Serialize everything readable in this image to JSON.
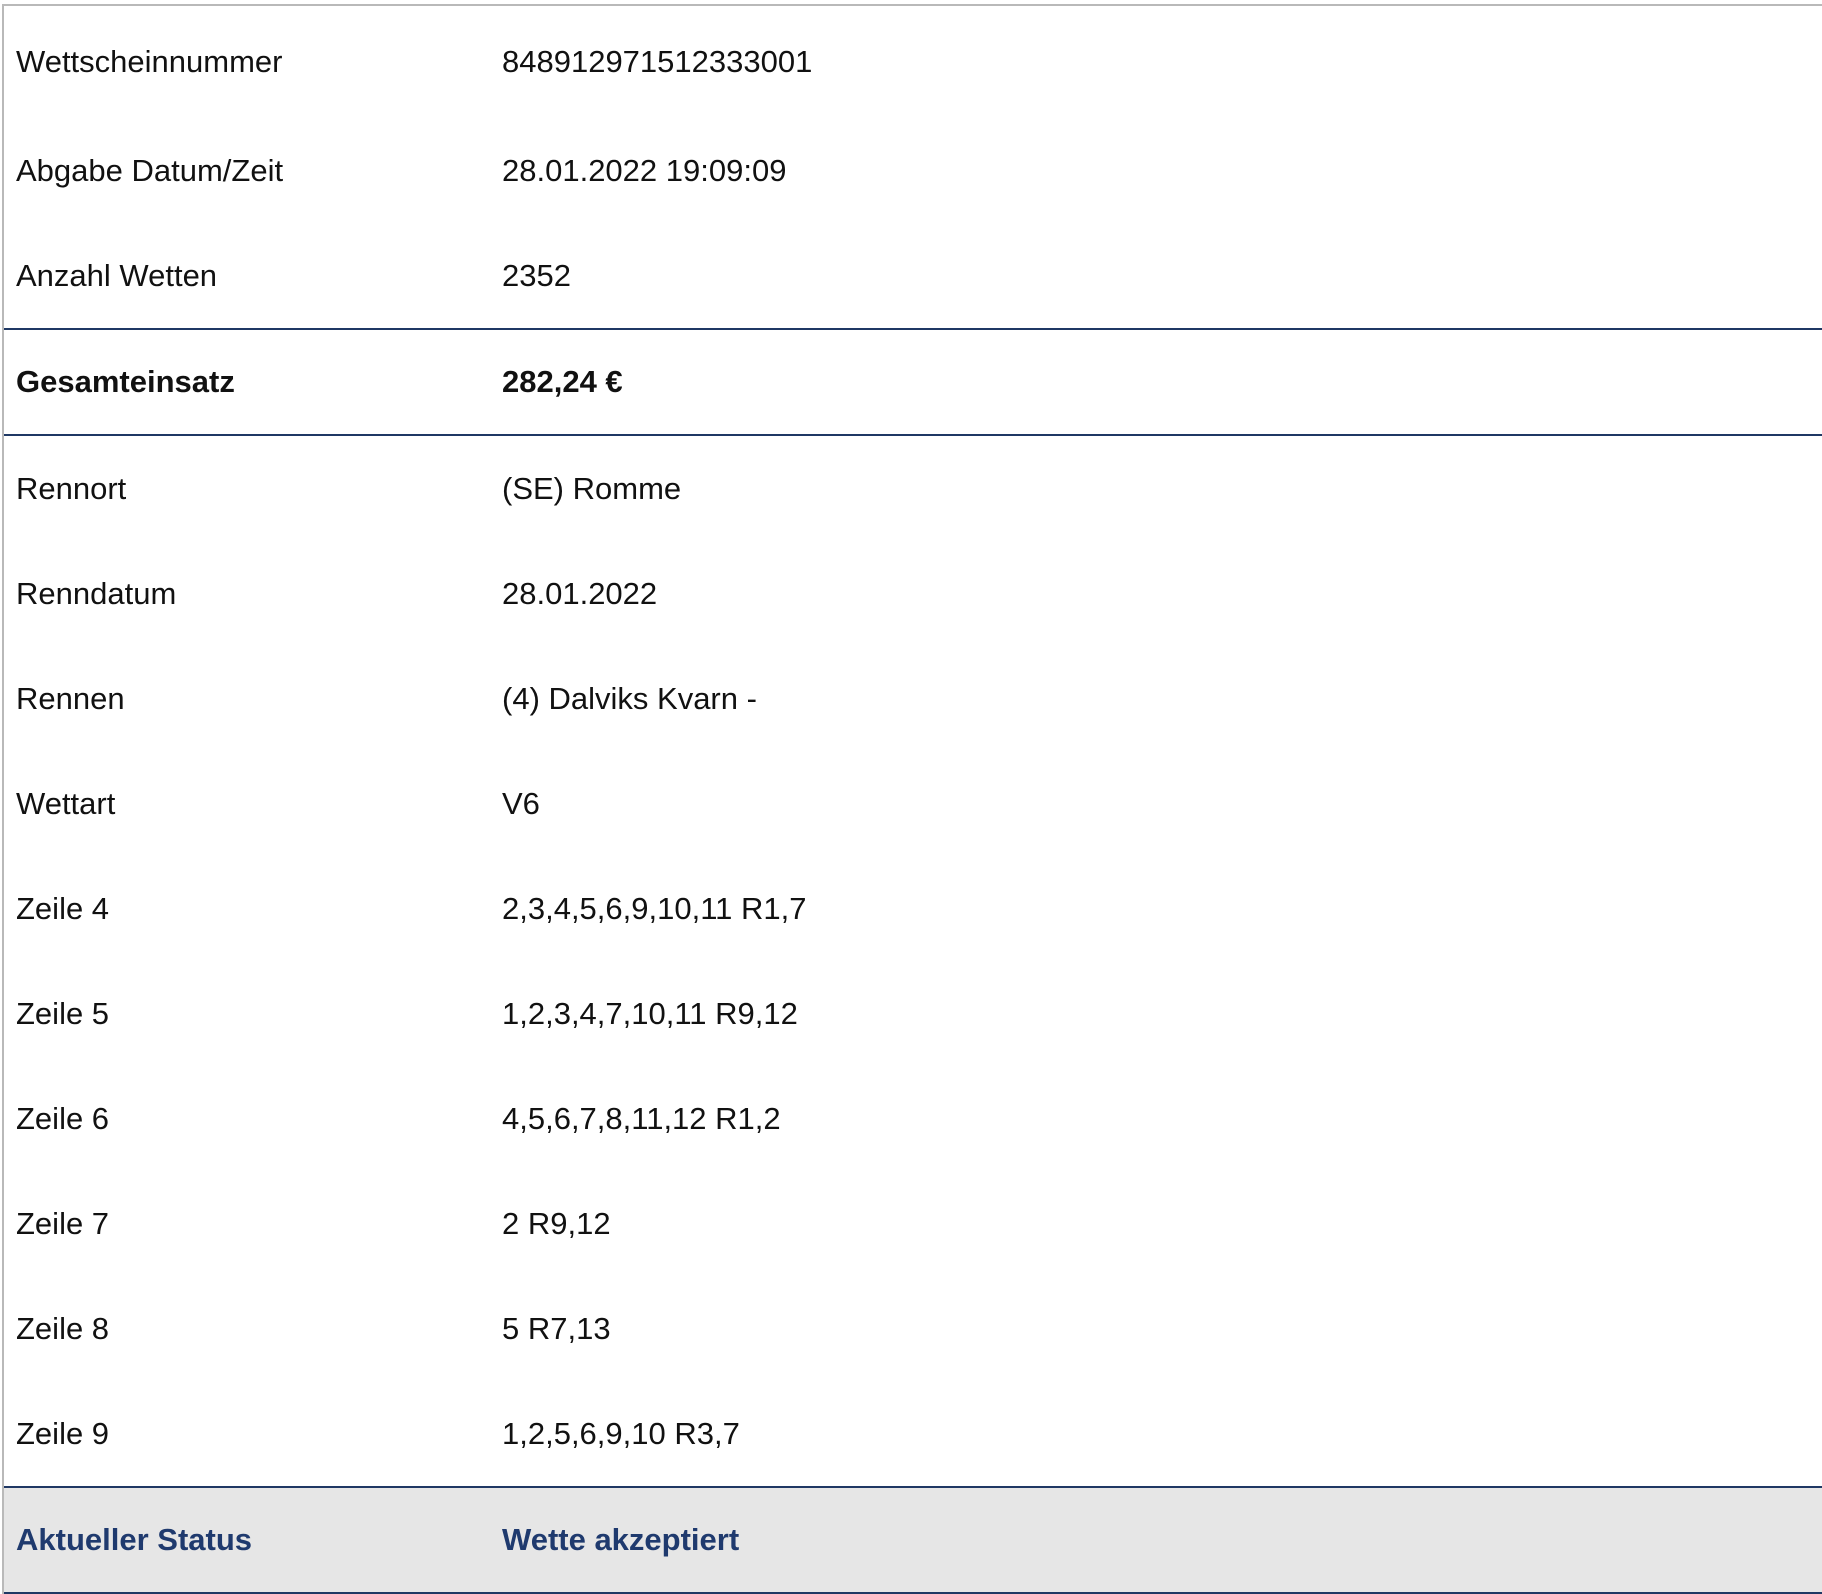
{
  "ticket": {
    "summary_rows": [
      {
        "label": "Wettscheinnummer",
        "value": "848912971512333001"
      },
      {
        "label": "Abgabe Datum/Zeit",
        "value": "28.01.2022 19:09:09"
      },
      {
        "label": "Anzahl Wetten",
        "value": "2352"
      }
    ],
    "total": {
      "label": "Gesamteinsatz",
      "value": "282,24 €"
    },
    "detail_rows": [
      {
        "label": "Rennort",
        "value": "(SE) Romme"
      },
      {
        "label": "Renndatum",
        "value": "28.01.2022"
      },
      {
        "label": "Rennen",
        "value": "(4) Dalviks Kvarn -"
      },
      {
        "label": "Wettart",
        "value": "V6"
      },
      {
        "label": "Zeile 4",
        "value": "2,3,4,5,6,9,10,11 R1,7"
      },
      {
        "label": "Zeile 5",
        "value": "1,2,3,4,7,10,11 R9,12"
      },
      {
        "label": "Zeile 6",
        "value": "4,5,6,7,8,11,12 R1,2"
      },
      {
        "label": "Zeile 7",
        "value": "2 R9,12"
      },
      {
        "label": "Zeile 8",
        "value": "5 R7,13"
      },
      {
        "label": "Zeile 9",
        "value": "1,2,5,6,9,10 R3,7"
      }
    ],
    "status": {
      "label": "Aktueller Status",
      "value": "Wette akzeptiert"
    }
  },
  "colors": {
    "accent_navy": "#1f3864",
    "status_text": "#1f3a6e",
    "status_background": "#e6e6e6"
  }
}
